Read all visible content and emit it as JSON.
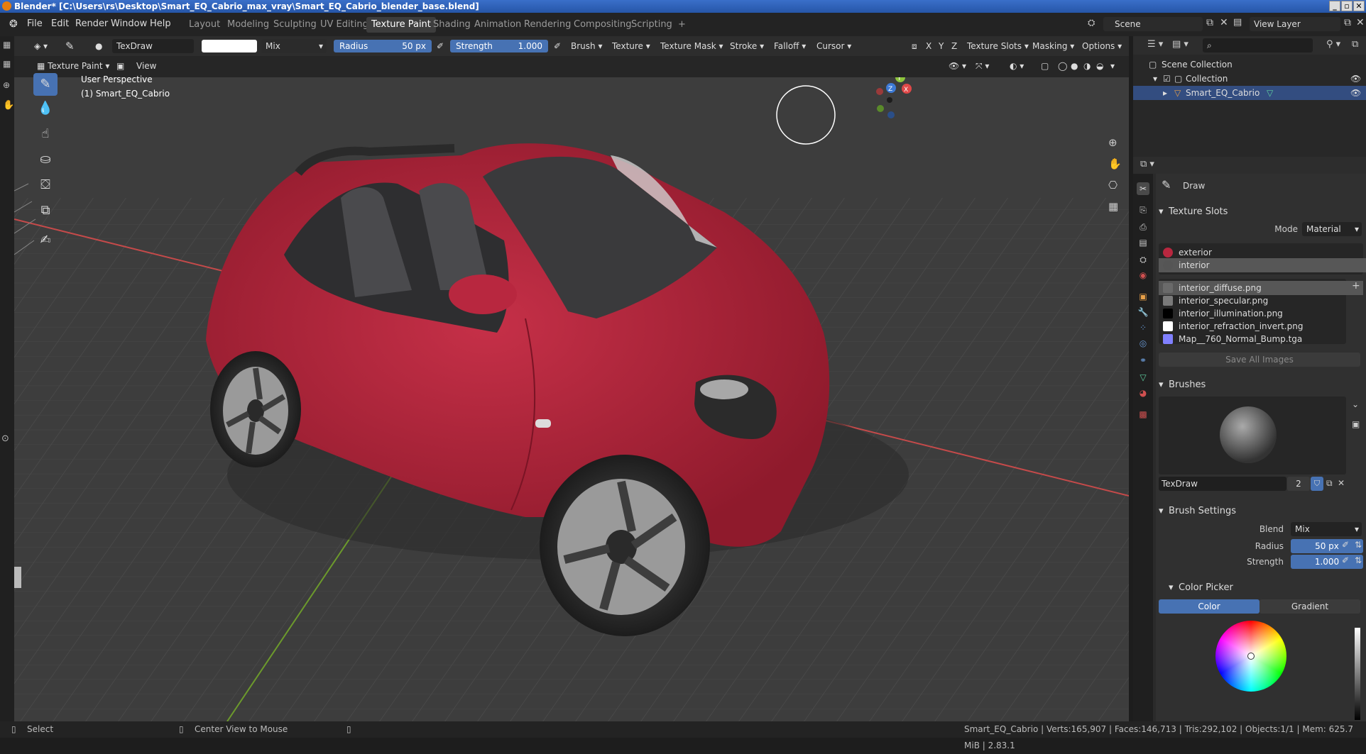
{
  "window": {
    "title": "Blender* [C:\\Users\\rs\\Desktop\\Smart_EQ_Cabrio_max_vray\\Smart_EQ_Cabrio_blender_base.blend]",
    "minimize": "_",
    "maximize": "▫",
    "close": "✕"
  },
  "menu": {
    "file": "File",
    "edit": "Edit",
    "render": "Render",
    "window": "Window",
    "help": "Help"
  },
  "workspaces": [
    "Layout",
    "Modeling",
    "Sculpting",
    "UV Editing",
    "Texture Paint",
    "Shading",
    "Animation",
    "Rendering",
    "Compositing",
    "Scripting"
  ],
  "workspace_add": "+",
  "scene": {
    "name": "Scene",
    "view_layer": "View Layer"
  },
  "tool_header": {
    "brush_name": "TexDraw",
    "blend": "Mix",
    "radius_label": "Radius",
    "radius_value": "50 px",
    "strength_label": "Strength",
    "strength_value": "1.000",
    "dropdowns": [
      "Brush",
      "Texture",
      "Texture Mask",
      "Stroke",
      "Falloff",
      "Cursor"
    ],
    "axes": [
      "X",
      "Y",
      "Z"
    ],
    "right_dropdowns": [
      "Texture Slots",
      "Masking",
      "Options"
    ]
  },
  "mode_header": {
    "mode": "Texture Paint",
    "view": "View"
  },
  "viewport": {
    "perspective": "User Perspective",
    "object": "(1) Smart_EQ_Cabrio",
    "gizmo_axes": [
      "Z",
      "Y",
      "X"
    ]
  },
  "outliner": {
    "scene_collection": "Scene Collection",
    "collection": "Collection",
    "object": "Smart_EQ_Cabrio"
  },
  "properties": {
    "tool_name": "Draw",
    "texture_slots": {
      "header": "Texture Slots",
      "mode_label": "Mode",
      "mode_value": "Material",
      "materials": [
        "exterior",
        "interior"
      ],
      "images": [
        {
          "name": "interior_diffuse.png",
          "color": "#6a6a6a"
        },
        {
          "name": "interior_specular.png",
          "color": "#7a7a7a"
        },
        {
          "name": "interior_illumination.png",
          "color": "#000000"
        },
        {
          "name": "interior_refraction_invert.png",
          "color": "#ffffff"
        },
        {
          "name": "Map__760_Normal_Bump.tga",
          "color": "#8080ff"
        }
      ],
      "save_all": "Save All Images"
    },
    "brushes": {
      "header": "Brushes",
      "name": "TexDraw",
      "users": "2"
    },
    "brush_settings": {
      "header": "Brush Settings",
      "blend_label": "Blend",
      "blend_value": "Mix",
      "radius_label": "Radius",
      "radius_value": "50 px",
      "strength_label": "Strength",
      "strength_value": "1.000"
    },
    "color_picker": {
      "header": "Color Picker",
      "tab_color": "Color",
      "tab_gradient": "Gradient"
    }
  },
  "statusbar": {
    "select": "Select",
    "center_view": "Center View to Mouse",
    "stats": "Smart_EQ_Cabrio | Verts:165,907 | Faces:146,713 | Tris:292,102 | Objects:1/1 | Mem: 625.7 MiB | 2.83.1"
  },
  "colors": {
    "accent": "#4772b3",
    "car_body": "#b8273f",
    "grid_bg": "#3d3d3d",
    "x_axis": "#c54a4a",
    "y_axis": "#6c9a2c"
  }
}
